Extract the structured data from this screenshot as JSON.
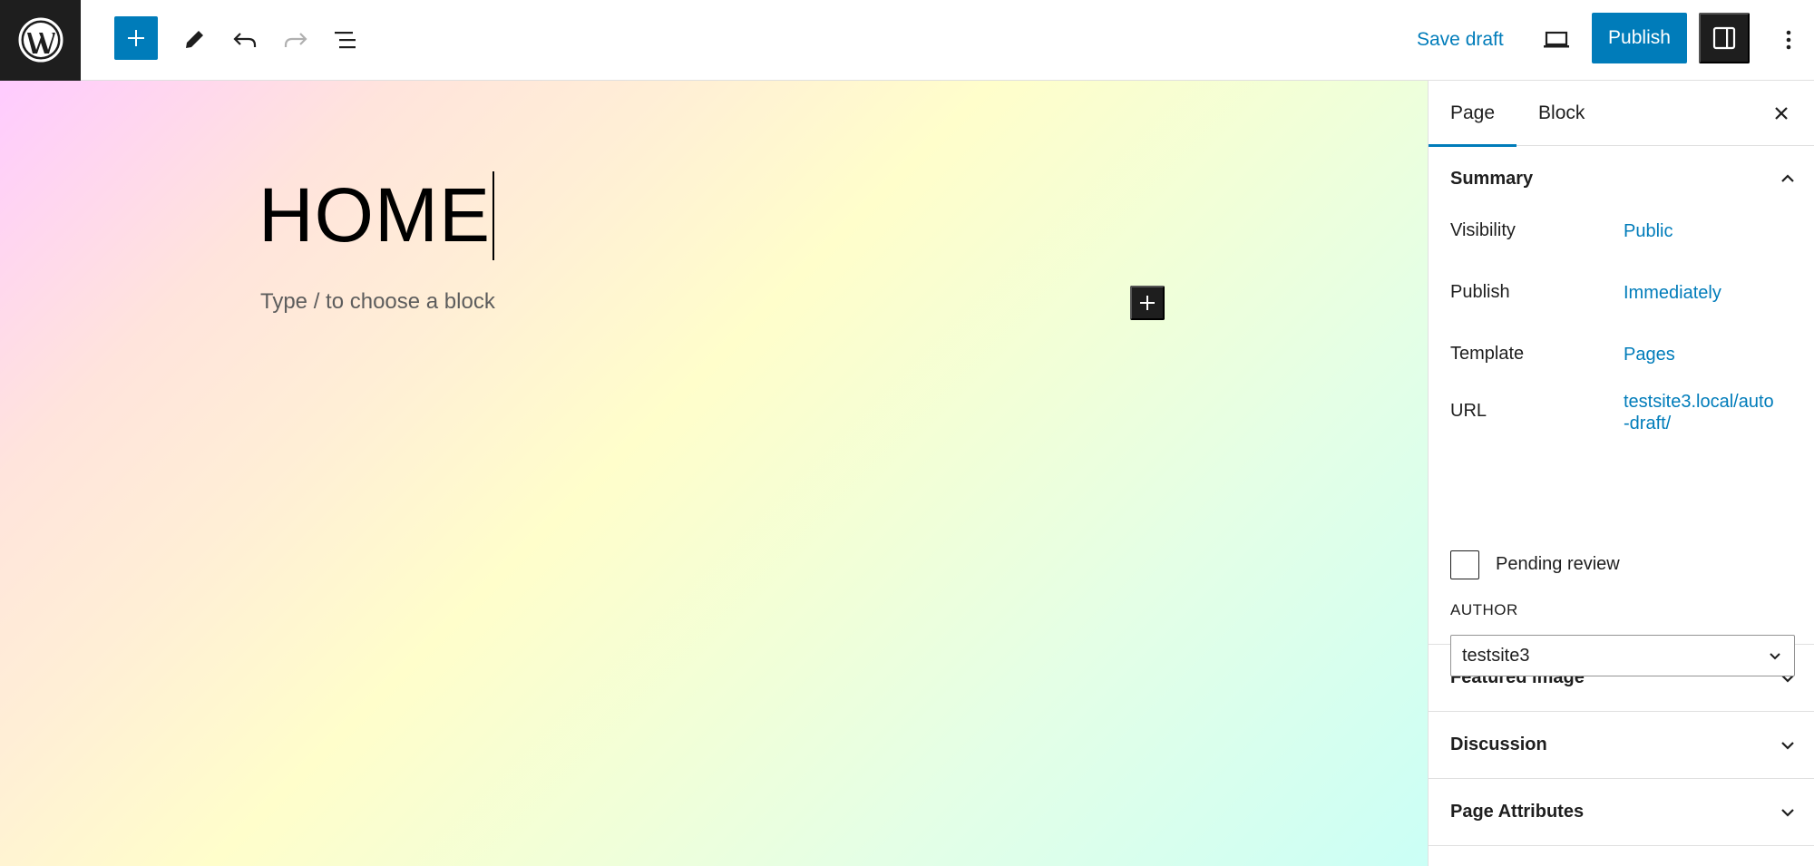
{
  "toolbar": {
    "save_draft_label": "Save draft",
    "publish_label": "Publish"
  },
  "editor": {
    "title": "HOME",
    "block_placeholder": "Type / to choose a block"
  },
  "sidebar": {
    "tabs": [
      {
        "label": "Page",
        "active": true
      },
      {
        "label": "Block",
        "active": false
      }
    ],
    "summary": {
      "heading": "Summary",
      "rows": [
        {
          "label": "Visibility",
          "value": "Public"
        },
        {
          "label": "Publish",
          "value": "Immediately"
        },
        {
          "label": "Template",
          "value": "Pages"
        },
        {
          "label": "URL",
          "value": "testsite3.local/auto-draft/"
        }
      ],
      "pending_review_label": "Pending review",
      "pending_review_checked": false,
      "author_label": "AUTHOR",
      "author_value": "testsite3"
    },
    "panels": [
      {
        "label": "Featured image"
      },
      {
        "label": "Discussion"
      },
      {
        "label": "Page Attributes"
      }
    ]
  },
  "colors": {
    "accent": "#007cba",
    "dark": "#1e1e1e"
  }
}
